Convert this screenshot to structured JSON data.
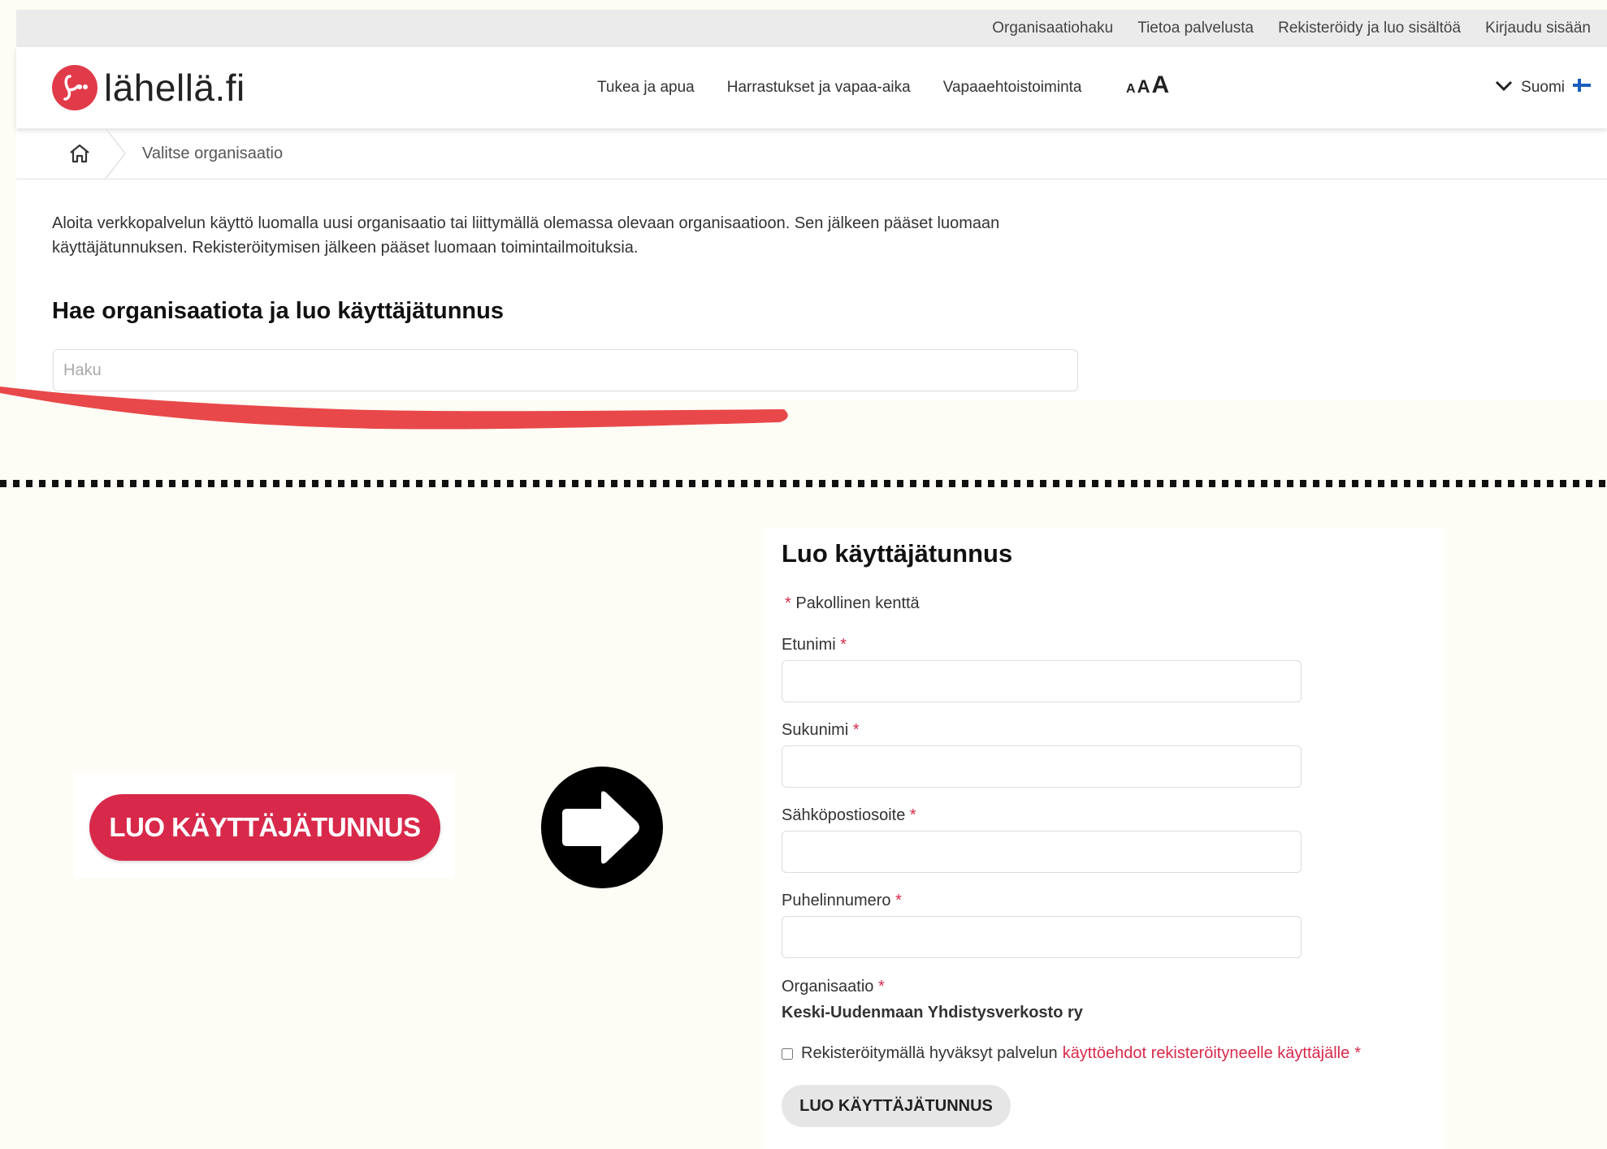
{
  "utility_nav": [
    "Organisaatiohaku",
    "Tietoa palvelusta",
    "Rekisteröidy ja luo sisältöä",
    "Kirjaudu sisään"
  ],
  "logo": {
    "text": "lähellä.fi"
  },
  "main_nav": [
    "Tukea ja apua",
    "Harrastukset ja vapaa-aika",
    "Vapaaehtoistoiminta"
  ],
  "text_size": [
    "A",
    "A",
    "A"
  ],
  "language": {
    "label": "Suomi",
    "icon": "chevron-down-icon"
  },
  "breadcrumb": {
    "home_icon": "home-icon",
    "current": "Valitse organisaatio"
  },
  "intro": "Aloita verkkopalvelun käyttö luomalla uusi organisaatio tai liittymällä olemassa olevaan organisaatioon. Sen jälkeen pääset luomaan käyttäjätunnuksen. Rekisteröitymisen jälkeen pääset luomaan toimintailmoituksia.",
  "search": {
    "heading": "Hae organisaatiota ja luo käyttäjätunnus",
    "placeholder": "Haku"
  },
  "cta_button": "LUO KÄYTTÄJÄTUNNUS",
  "arrow_icon": "arrow-right-circle-icon",
  "form": {
    "title": "Luo käyttäjätunnus",
    "required_note": "Pakollinen kenttä",
    "fields": {
      "first_name": "Etunimi",
      "last_name": "Sukunimi",
      "email": "Sähköpostiosoite",
      "phone": "Puhelinnumero"
    },
    "organization_label": "Organisaatio",
    "organization_value": "Keski-Uudenmaan Yhdistysverkosto ry",
    "terms_prefix": "Rekisteröitymällä hyväksyt palvelun",
    "terms_link": "käyttöehdot rekisteröityneelle käyttäjälle",
    "submit": "LUO KÄYTTÄJÄTUNNUS"
  },
  "colors": {
    "brand_red": "#d8294b",
    "logo_red": "#e13b4a",
    "marker_red": "#e8484a",
    "background": "#fdfdf5"
  }
}
